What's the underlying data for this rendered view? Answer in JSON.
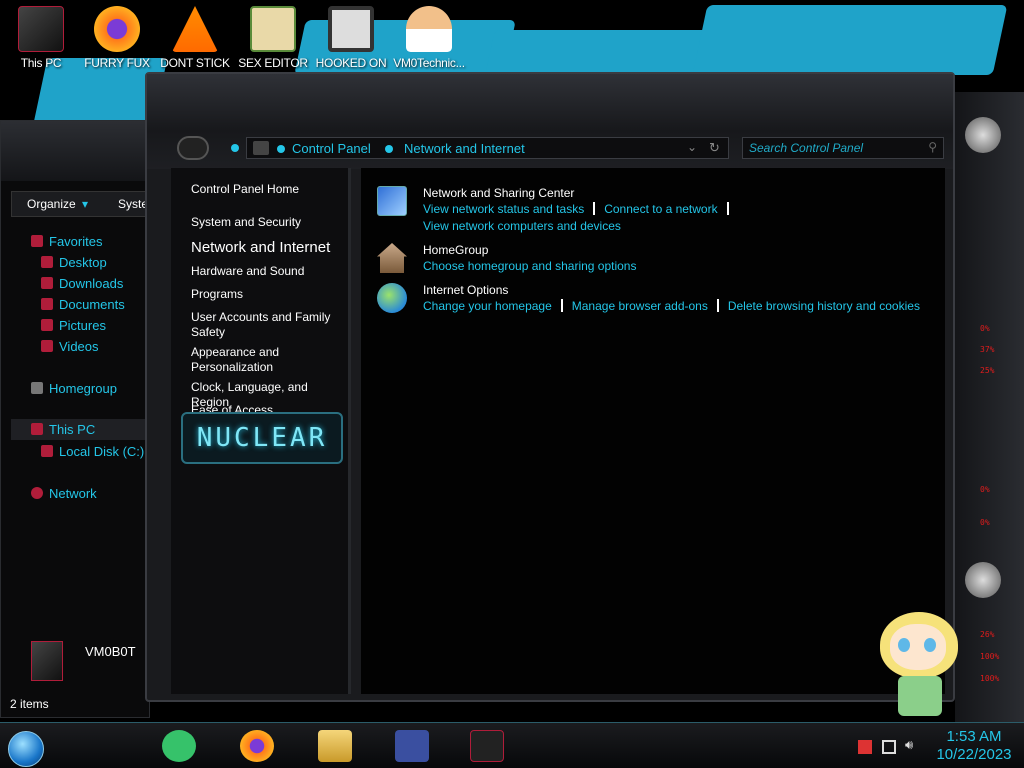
{
  "desktop": {
    "icons": [
      {
        "label": "This PC",
        "icon": "this-pc-icon",
        "color": "#b01d3a"
      },
      {
        "label": "FURRY FUX",
        "icon": "firefox-icon",
        "color": "#ff7a1a"
      },
      {
        "label": "DONT STICK",
        "icon": "vlc-icon",
        "color": "#ff8c00"
      },
      {
        "label": "SEX EDITOR",
        "icon": "hxd-icon",
        "color": "#d9b45a"
      },
      {
        "label": "HOOKED ON",
        "icon": "app-icon",
        "color": "#333333"
      },
      {
        "label": "VM0Technic...",
        "icon": "doctor-icon",
        "color": "#f2c08a"
      }
    ]
  },
  "explorer": {
    "toolbar": {
      "organize": "Organize",
      "system": "Syste"
    },
    "nav": {
      "favorites": "Favorites",
      "desktop": "Desktop",
      "downloads": "Downloads",
      "documents": "Documents",
      "pictures": "Pictures",
      "videos": "Videos",
      "homegroup": "Homegroup",
      "this_pc": "This PC",
      "local_disk": "Local Disk (C:)",
      "network": "Network"
    },
    "details_name": "VM0B0T",
    "status": "2 items"
  },
  "control_panel": {
    "breadcrumb": [
      "Control Panel",
      "Network and Internet"
    ],
    "search_placeholder": "Search Control Panel",
    "sidebar": {
      "home": "Control Panel Home",
      "system_security": "System and Security",
      "network_internet": "Network and Internet",
      "hardware_sound": "Hardware and Sound",
      "programs": "Programs",
      "user_accounts": "User Accounts and Family Safety",
      "appearance": "Appearance and Personalization",
      "clock": "Clock, Language, and Region",
      "ease": "Ease of Access"
    },
    "nuclear_logo": "NUCLEAR",
    "categories": {
      "network_sharing": {
        "title": "Network and Sharing Center",
        "links": [
          "View network status and tasks",
          "Connect to a network",
          "View network computers and devices"
        ]
      },
      "homegroup": {
        "title": "HomeGroup",
        "links": [
          "Choose homegroup and sharing options"
        ]
      },
      "internet_options": {
        "title": "Internet Options",
        "links": [
          "Change your homepage",
          "Manage browser add-ons",
          "Delete browsing history and cookies"
        ]
      }
    }
  },
  "meters": [
    "0%",
    "37%",
    "25%",
    "0%",
    "0%",
    "26%",
    "100%",
    "100%"
  ],
  "taskbar": {
    "time": "1:53 AM",
    "date": "10/22/2023"
  },
  "colors": {
    "accent": "#24c6e8",
    "wall": "#1fa3c9",
    "alert": "#e01c1c"
  }
}
